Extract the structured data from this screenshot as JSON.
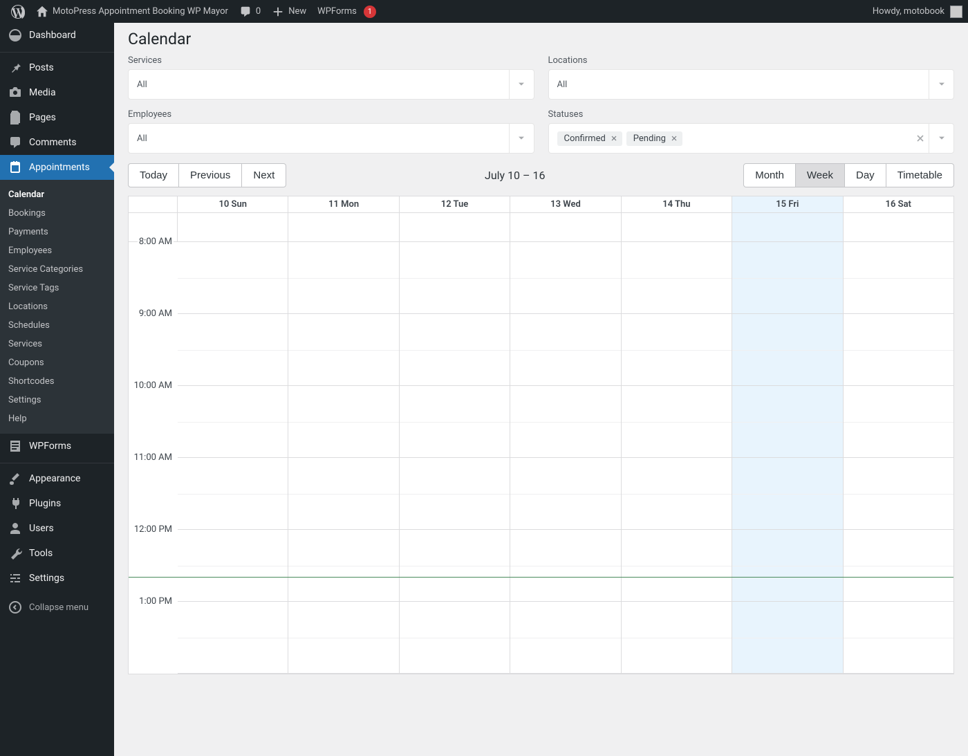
{
  "adminbar": {
    "site_title": "MotoPress Appointment Booking WP Mayor",
    "comments_count": "0",
    "new_label": "New",
    "wpforms_label": "WPForms",
    "wpforms_badge": "1",
    "howdy": "Howdy, motobook"
  },
  "sidebar": {
    "items": [
      {
        "label": "Dashboard"
      },
      {
        "label": "Posts"
      },
      {
        "label": "Media"
      },
      {
        "label": "Pages"
      },
      {
        "label": "Comments"
      },
      {
        "label": "Appointments"
      },
      {
        "label": "WPForms"
      },
      {
        "label": "Appearance"
      },
      {
        "label": "Plugins"
      },
      {
        "label": "Users"
      },
      {
        "label": "Tools"
      },
      {
        "label": "Settings"
      }
    ],
    "submenu": [
      {
        "label": "Calendar"
      },
      {
        "label": "Bookings"
      },
      {
        "label": "Payments"
      },
      {
        "label": "Employees"
      },
      {
        "label": "Service Categories"
      },
      {
        "label": "Service Tags"
      },
      {
        "label": "Locations"
      },
      {
        "label": "Schedules"
      },
      {
        "label": "Services"
      },
      {
        "label": "Coupons"
      },
      {
        "label": "Shortcodes"
      },
      {
        "label": "Settings"
      },
      {
        "label": "Help"
      }
    ],
    "collapse": "Collapse menu"
  },
  "page": {
    "title": "Calendar",
    "filters": {
      "services_label": "Services",
      "services_value": "All",
      "locations_label": "Locations",
      "locations_value": "All",
      "employees_label": "Employees",
      "employees_value": "All",
      "statuses_label": "Statuses",
      "statuses_tags": [
        "Confirmed",
        "Pending"
      ]
    },
    "toolbar": {
      "today": "Today",
      "previous": "Previous",
      "next": "Next",
      "range": "July 10 – 16",
      "month": "Month",
      "week": "Week",
      "day": "Day",
      "timetable": "Timetable"
    },
    "days": [
      {
        "label": "10 Sun"
      },
      {
        "label": "11 Mon"
      },
      {
        "label": "12 Tue"
      },
      {
        "label": "13 Wed"
      },
      {
        "label": "14 Thu"
      },
      {
        "label": "15 Fri",
        "today": true
      },
      {
        "label": "16 Sat"
      }
    ],
    "time_labels": [
      "8:00 AM",
      "9:00 AM",
      "10:00 AM",
      "11:00 AM",
      "12:00 PM",
      "1:00 PM"
    ]
  }
}
